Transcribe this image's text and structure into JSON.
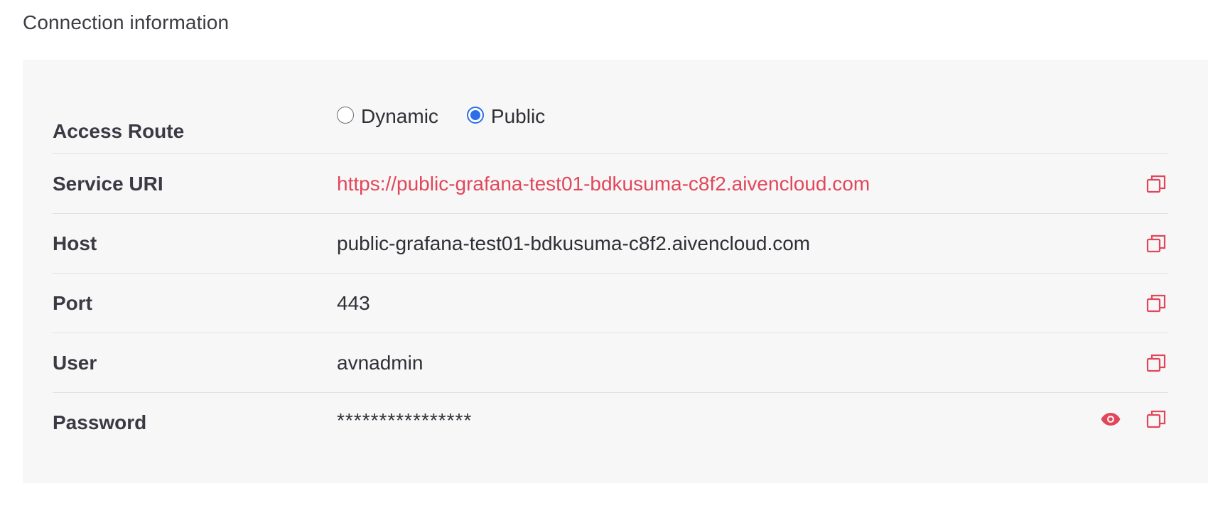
{
  "section": {
    "title": "Connection information"
  },
  "access_route": {
    "label": "Access Route",
    "options": [
      {
        "label": "Dynamic",
        "selected": false
      },
      {
        "label": "Public",
        "selected": true
      }
    ]
  },
  "rows": [
    {
      "label": "Service URI",
      "value": "https://public-grafana-test01-bdkusuma-c8f2.aivencloud.com",
      "is_link": true
    },
    {
      "label": "Host",
      "value": "public-grafana-test01-bdkusuma-c8f2.aivencloud.com"
    },
    {
      "label": "Port",
      "value": "443"
    },
    {
      "label": "User",
      "value": "avnadmin"
    },
    {
      "label": "Password",
      "value": "****************"
    }
  ],
  "icons": {
    "copy": "copy-icon",
    "reveal": "eye-icon"
  },
  "colors": {
    "accent": "#e2465a",
    "radio_selected": "#2d6fe6",
    "panel_background": "#f7f7f7",
    "divider": "#e1e1e4"
  }
}
